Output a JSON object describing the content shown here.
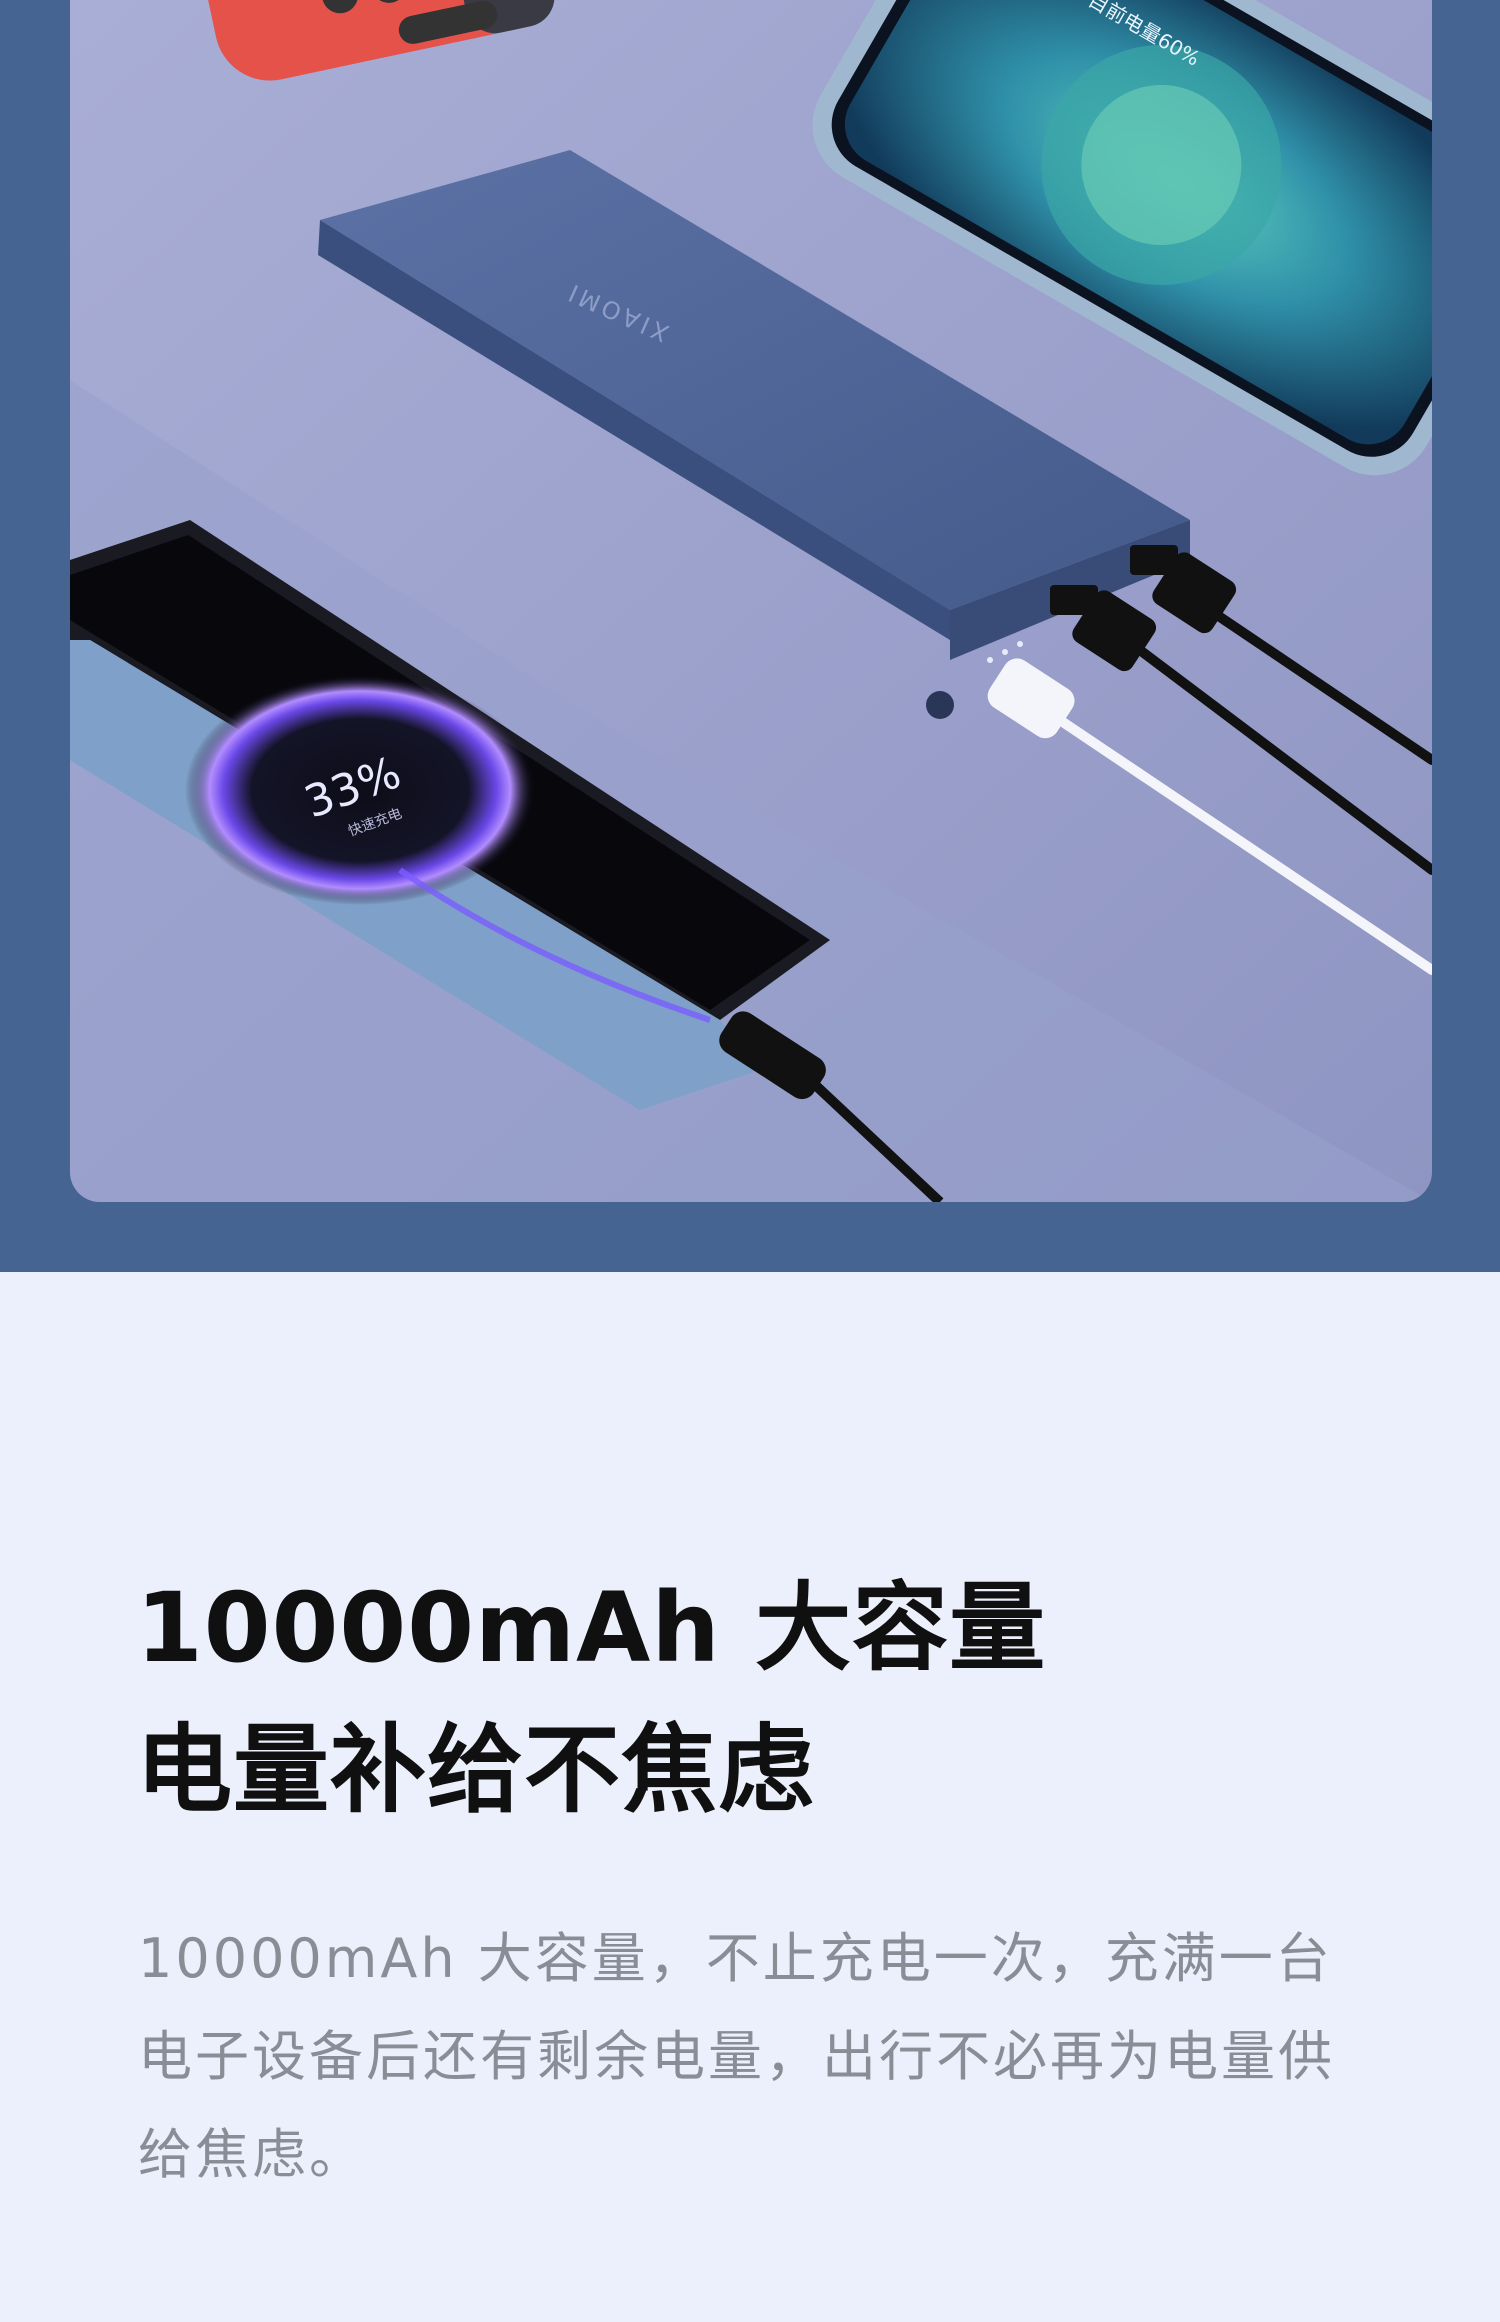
{
  "hero_image": {
    "brand_mark": "XIAOMI",
    "iphone_screen_text": "目前电量60%",
    "android_charge_percent": "33%",
    "android_charge_status": "快速充电",
    "colors": {
      "band": "#466491",
      "surface": "#9ea4cc",
      "powerbank": "#4f6494",
      "switch_controller": "#e5524a"
    }
  },
  "headline": {
    "line1": "10000mAh 大容量",
    "line2": "电量补给不焦虑"
  },
  "description": {
    "text": "10000mAh 大容量，不止充电一次，充满一台电子设备后还有剩余电量，出行不必再为电量供给焦虑。"
  }
}
